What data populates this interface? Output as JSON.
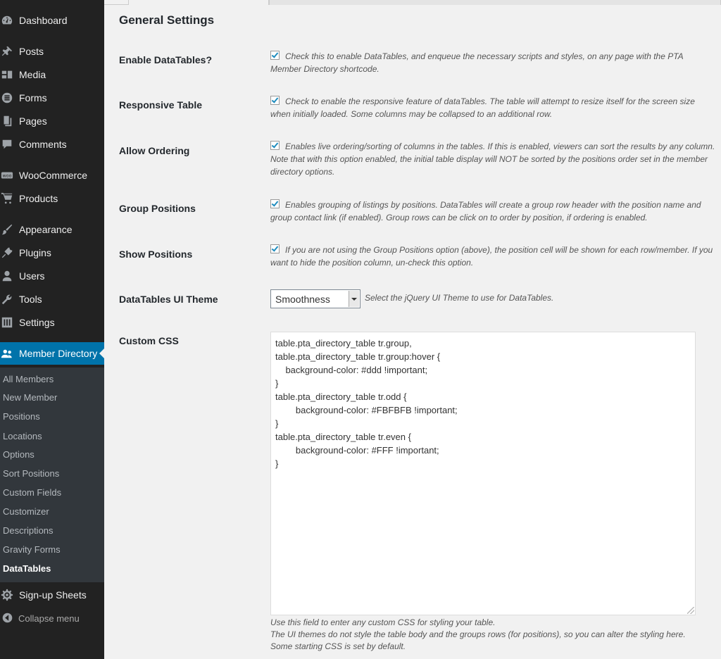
{
  "sidebar": {
    "items": [
      {
        "label": "Dashboard",
        "icon": "dashboard-icon"
      },
      {
        "label": "Posts",
        "icon": "pin-icon"
      },
      {
        "label": "Media",
        "icon": "media-icon"
      },
      {
        "label": "Forms",
        "icon": "forms-icon"
      },
      {
        "label": "Pages",
        "icon": "pages-icon"
      },
      {
        "label": "Comments",
        "icon": "comment-icon"
      },
      {
        "label": "WooCommerce",
        "icon": "woocommerce-icon"
      },
      {
        "label": "Products",
        "icon": "cart-icon"
      },
      {
        "label": "Appearance",
        "icon": "brush-icon"
      },
      {
        "label": "Plugins",
        "icon": "plugin-icon"
      },
      {
        "label": "Users",
        "icon": "user-icon"
      },
      {
        "label": "Tools",
        "icon": "wrench-icon"
      },
      {
        "label": "Settings",
        "icon": "settings-icon"
      },
      {
        "label": "Member Directory",
        "icon": "member-directory-icon"
      },
      {
        "label": "Sign-up Sheets",
        "icon": "gear-icon"
      }
    ],
    "submenu": [
      "All Members",
      "New Member",
      "Positions",
      "Locations",
      "Options",
      "Sort Positions",
      "Custom Fields",
      "Customizer",
      "Descriptions",
      "Gravity Forms",
      "DataTables"
    ],
    "collapse_label": "Collapse menu",
    "accent_color": "#0073aa"
  },
  "main": {
    "section_title": "General Settings",
    "rows": [
      {
        "label": "Enable DataTables?",
        "checked": true,
        "description": "Check this to enable DataTables, and enqueue the necessary scripts and styles, on any page with the PTA Member Directory shortcode."
      },
      {
        "label": "Responsive Table",
        "checked": true,
        "description": "Check to enable the responsive feature of dataTables. The table will attempt to resize itself for the screen size when initially loaded. Some columns may be collapsed to an additional row."
      },
      {
        "label": "Allow Ordering",
        "checked": true,
        "description": "Enables live ordering/sorting of columns in the tables. If this is enabled, viewers can sort the results by any column. Note that with this option enabled, the initial table display will NOT be sorted by the positions order set in the member directory options."
      },
      {
        "label": "Group Positions",
        "checked": true,
        "description": "Enables grouping of listings by positions. DataTables will create a group row header with the position name and group contact link (if enabled). Group rows can be click on to order by position, if ordering is enabled."
      },
      {
        "label": "Show Positions",
        "checked": true,
        "description": "If you are not using the Group Positions option (above), the position cell will be shown for each row/member. If you want to hide the position column, un-check this option."
      }
    ],
    "theme": {
      "label": "DataTables UI Theme",
      "selected": "Smoothness",
      "description": "Select the jQuery UI Theme to use for DataTables."
    },
    "custom_css": {
      "label": "Custom CSS",
      "value": "table.pta_directory_table tr.group,\ntable.pta_directory_table tr.group:hover {\n    background-color: #ddd !important;\n}\ntable.pta_directory_table tr.odd {\n        background-color: #FBFBFB !important;\n}\ntable.pta_directory_table tr.even {\n        background-color: #FFF !important;\n}",
      "help_lines": [
        "Use this field to enter any custom CSS for styling your table.",
        "The UI themes do not style the table body and the groups rows (for positions), so you can alter the styling here.",
        "Some starting CSS is set by default."
      ]
    }
  }
}
